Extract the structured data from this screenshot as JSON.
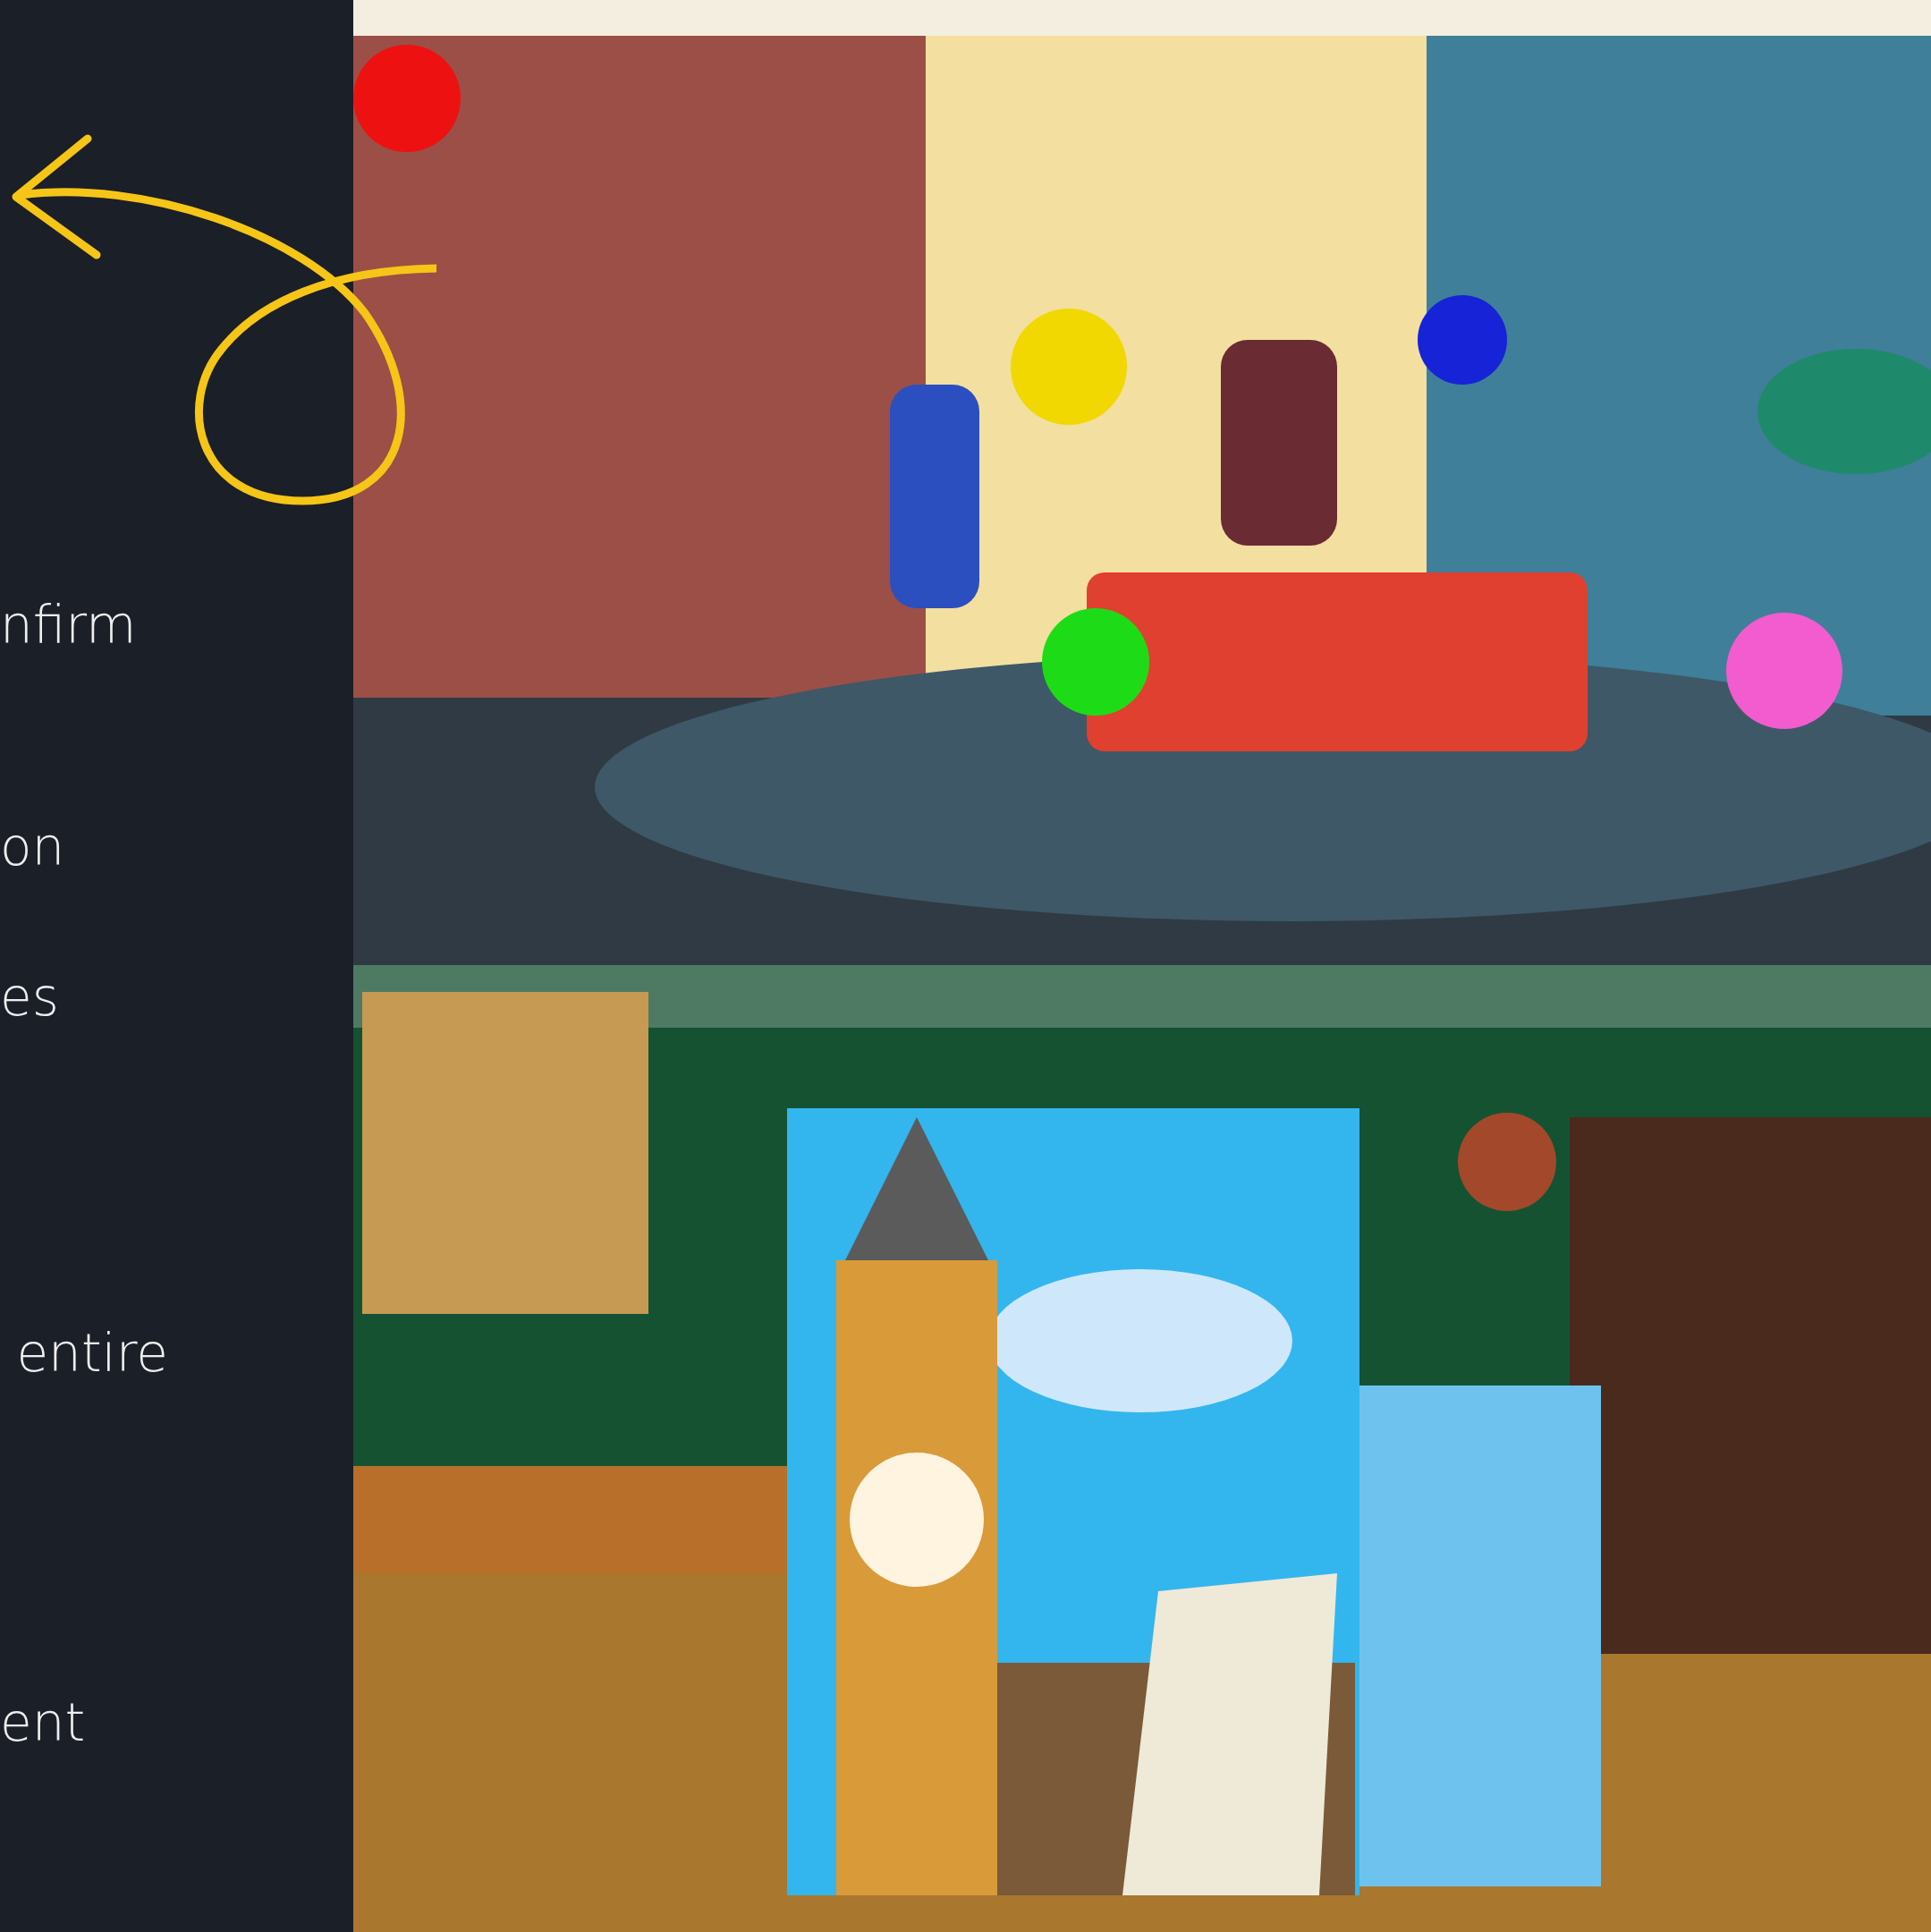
{
  "side_texts": [
    "nfirm",
    "on",
    "es",
    " entire",
    "ent"
  ]
}
